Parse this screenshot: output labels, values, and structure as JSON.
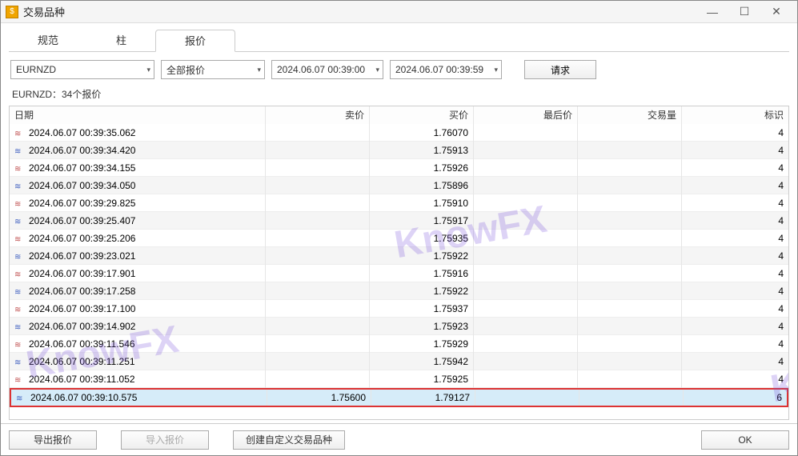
{
  "window": {
    "title": "交易品种"
  },
  "tabs": {
    "spec": "规范",
    "bar": "柱",
    "quote": "报价"
  },
  "filter": {
    "symbol": "EURNZD",
    "type": "全部报价",
    "from": "2024.06.07 00:39:00",
    "to": "2024.06.07 00:39:59",
    "request": "请求"
  },
  "info": "EURNZD：34个报价",
  "columns": {
    "date": "日期",
    "ask": "卖价",
    "bid": "买价",
    "last": "最后价",
    "vol": "交易量",
    "flag": "标识"
  },
  "rows": [
    {
      "date": "2024.06.07 00:39:35.062",
      "ask": "",
      "bid": "1.76070",
      "last": "",
      "vol": "",
      "flag": "4",
      "alt": false
    },
    {
      "date": "2024.06.07 00:39:34.420",
      "ask": "",
      "bid": "1.75913",
      "last": "",
      "vol": "",
      "flag": "4",
      "alt": true
    },
    {
      "date": "2024.06.07 00:39:34.155",
      "ask": "",
      "bid": "1.75926",
      "last": "",
      "vol": "",
      "flag": "4",
      "alt": false
    },
    {
      "date": "2024.06.07 00:39:34.050",
      "ask": "",
      "bid": "1.75896",
      "last": "",
      "vol": "",
      "flag": "4",
      "alt": true
    },
    {
      "date": "2024.06.07 00:39:29.825",
      "ask": "",
      "bid": "1.75910",
      "last": "",
      "vol": "",
      "flag": "4",
      "alt": false
    },
    {
      "date": "2024.06.07 00:39:25.407",
      "ask": "",
      "bid": "1.75917",
      "last": "",
      "vol": "",
      "flag": "4",
      "alt": true
    },
    {
      "date": "2024.06.07 00:39:25.206",
      "ask": "",
      "bid": "1.75935",
      "last": "",
      "vol": "",
      "flag": "4",
      "alt": false
    },
    {
      "date": "2024.06.07 00:39:23.021",
      "ask": "",
      "bid": "1.75922",
      "last": "",
      "vol": "",
      "flag": "4",
      "alt": true
    },
    {
      "date": "2024.06.07 00:39:17.901",
      "ask": "",
      "bid": "1.75916",
      "last": "",
      "vol": "",
      "flag": "4",
      "alt": false
    },
    {
      "date": "2024.06.07 00:39:17.258",
      "ask": "",
      "bid": "1.75922",
      "last": "",
      "vol": "",
      "flag": "4",
      "alt": true
    },
    {
      "date": "2024.06.07 00:39:17.100",
      "ask": "",
      "bid": "1.75937",
      "last": "",
      "vol": "",
      "flag": "4",
      "alt": false
    },
    {
      "date": "2024.06.07 00:39:14.902",
      "ask": "",
      "bid": "1.75923",
      "last": "",
      "vol": "",
      "flag": "4",
      "alt": true
    },
    {
      "date": "2024.06.07 00:39:11.546",
      "ask": "",
      "bid": "1.75929",
      "last": "",
      "vol": "",
      "flag": "4",
      "alt": false
    },
    {
      "date": "2024.06.07 00:39:11.251",
      "ask": "",
      "bid": "1.75942",
      "last": "",
      "vol": "",
      "flag": "4",
      "alt": true
    },
    {
      "date": "2024.06.07 00:39:11.052",
      "ask": "",
      "bid": "1.75925",
      "last": "",
      "vol": "",
      "flag": "4",
      "alt": false
    },
    {
      "date": "2024.06.07 00:39:10.575",
      "ask": "1.75600",
      "bid": "1.79127",
      "last": "",
      "vol": "",
      "flag": "6",
      "alt": false,
      "highlight": true
    }
  ],
  "footer": {
    "export": "导出报价",
    "import": "导入报价",
    "create": "创建自定义交易品种",
    "ok": "OK"
  },
  "watermark": "KnowFX"
}
